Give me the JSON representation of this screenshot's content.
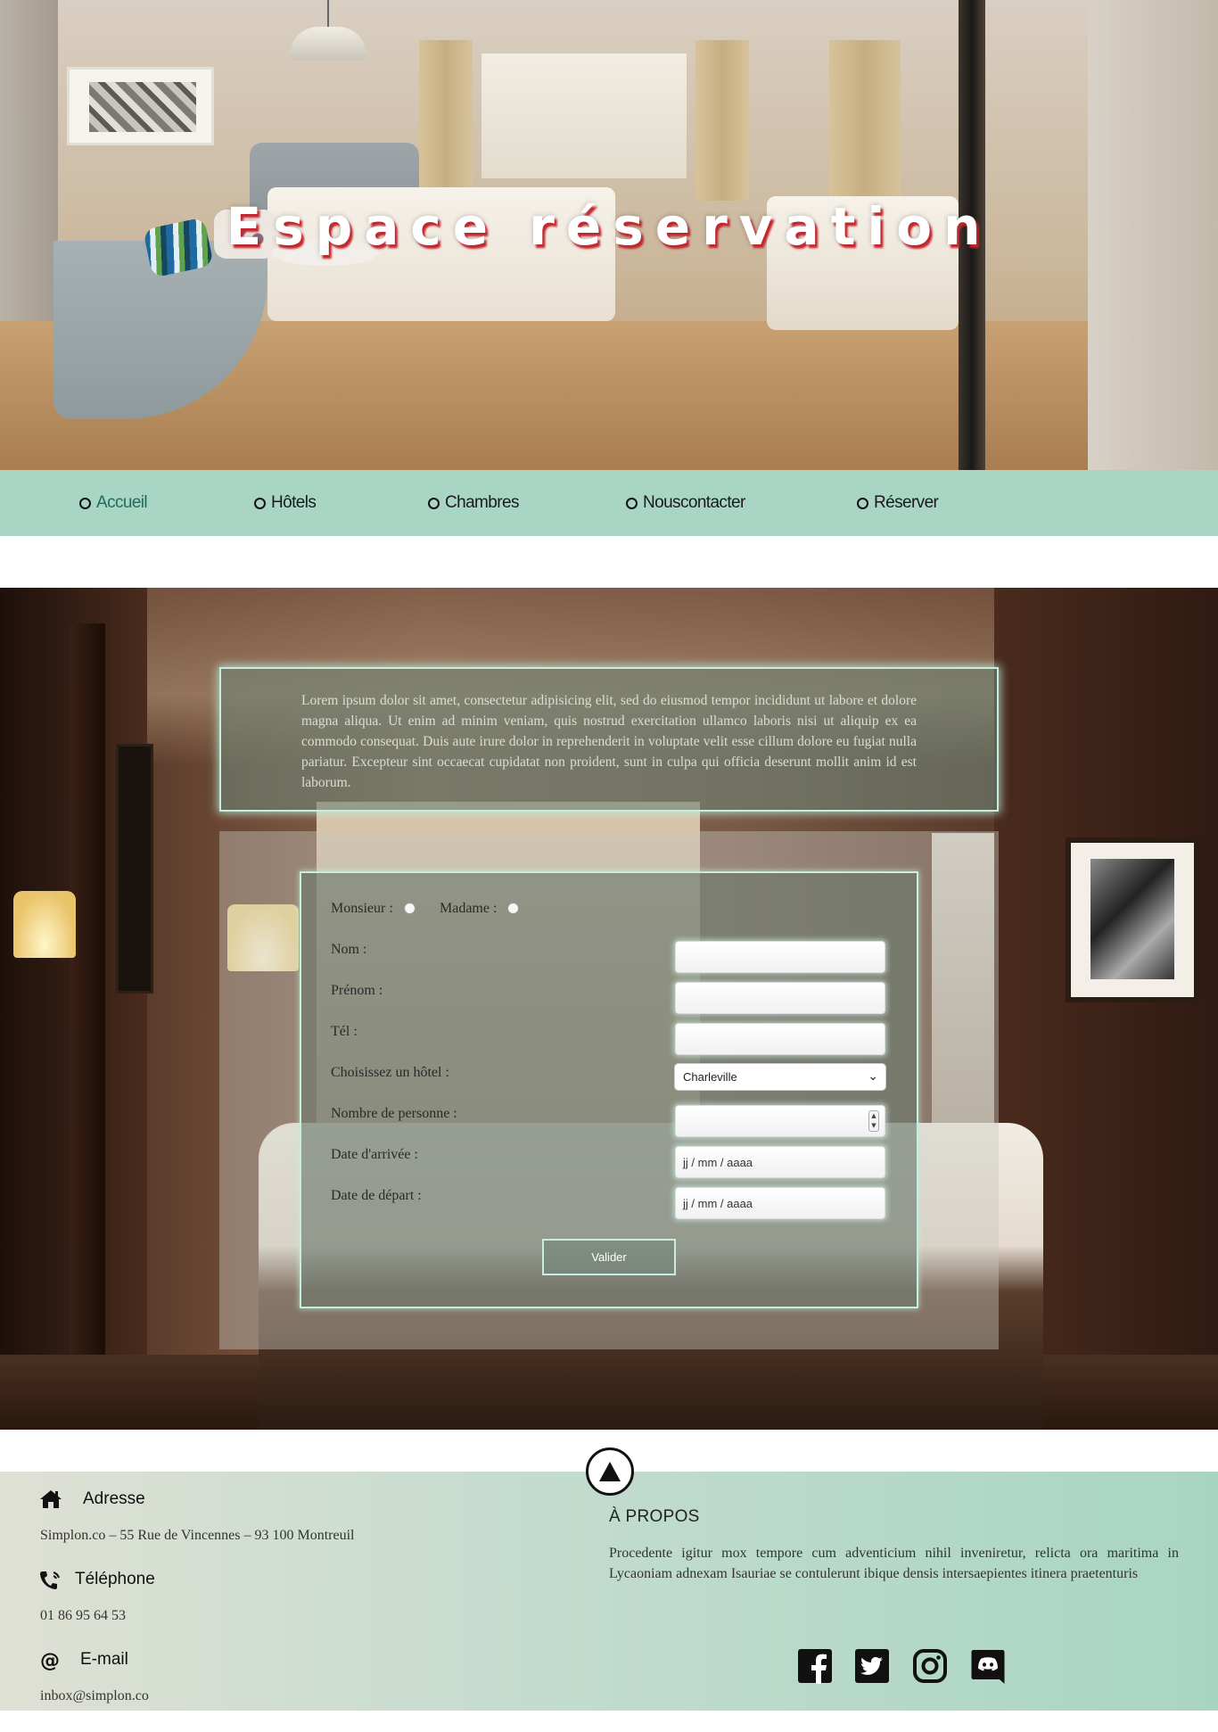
{
  "hero": {
    "title": "Espace réservation"
  },
  "nav": {
    "items": [
      {
        "label": "Accueil",
        "active": true
      },
      {
        "label": "Hôtels",
        "active": false
      },
      {
        "label": "Chambres",
        "active": false
      },
      {
        "label": "Nouscontacter",
        "active": false
      },
      {
        "label": "Réserver",
        "active": false
      }
    ]
  },
  "intro": {
    "text": "Lorem ipsum dolor sit amet, consectetur adipisicing elit, sed do eiusmod tempor incididunt ut labore et dolore magna aliqua. Ut enim ad minim veniam, quis nostrud exercitation ullamco laboris nisi ut aliquip ex ea commodo consequat. Duis aute irure dolor in reprehenderit in voluptate velit esse cillum dolore eu fugiat nulla pariatur. Excepteur sint occaecat cupidatat non proident, sunt in culpa qui officia deserunt mollit anim id est laborum."
  },
  "form": {
    "civility": {
      "monsieur": "Monsieur :",
      "madame": "Madame :"
    },
    "nom_label": "Nom :",
    "prenom_label": "Prénom :",
    "tel_label": "Tél :",
    "hotel_label": "Choisissez un hôtel :",
    "hotel_selected": "Charleville",
    "personnes_label": "Nombre de personne :",
    "arrivee_label": "Date d'arrivée :",
    "arrivee_placeholder": "jj / mm / aaaa",
    "depart_label": "Date de départ :",
    "depart_placeholder": "jj / mm / aaaa",
    "submit_label": "Valider"
  },
  "footer": {
    "address_heading": "Adresse",
    "address_text": "Simplon.co – 55 Rue de Vincennes – 93 100 Montreuil",
    "phone_heading": "Téléphone",
    "phone_text": "01 86 95 64 53",
    "email_heading": "E-mail",
    "email_text": "inbox@simplon.co",
    "about_title": "À PROPOS",
    "about_text": "Procedente igitur mox tempore cum adventicium nihil inveniretur, relicta ora maritima in Lycaoniam adnexam Isauriae se contulerunt ibique densis intersaepientes itinera praetenturis",
    "social_icons": [
      "facebook-icon",
      "twitter-icon",
      "instagram-icon",
      "discord-icon"
    ]
  },
  "colors": {
    "nav_bg": "#a9d6c4",
    "accent": "#1f6b5e",
    "title_shadow": "#c1272d",
    "footer_gradient_start": "#dfe0d4",
    "footer_gradient_end": "#a8d5c2"
  }
}
